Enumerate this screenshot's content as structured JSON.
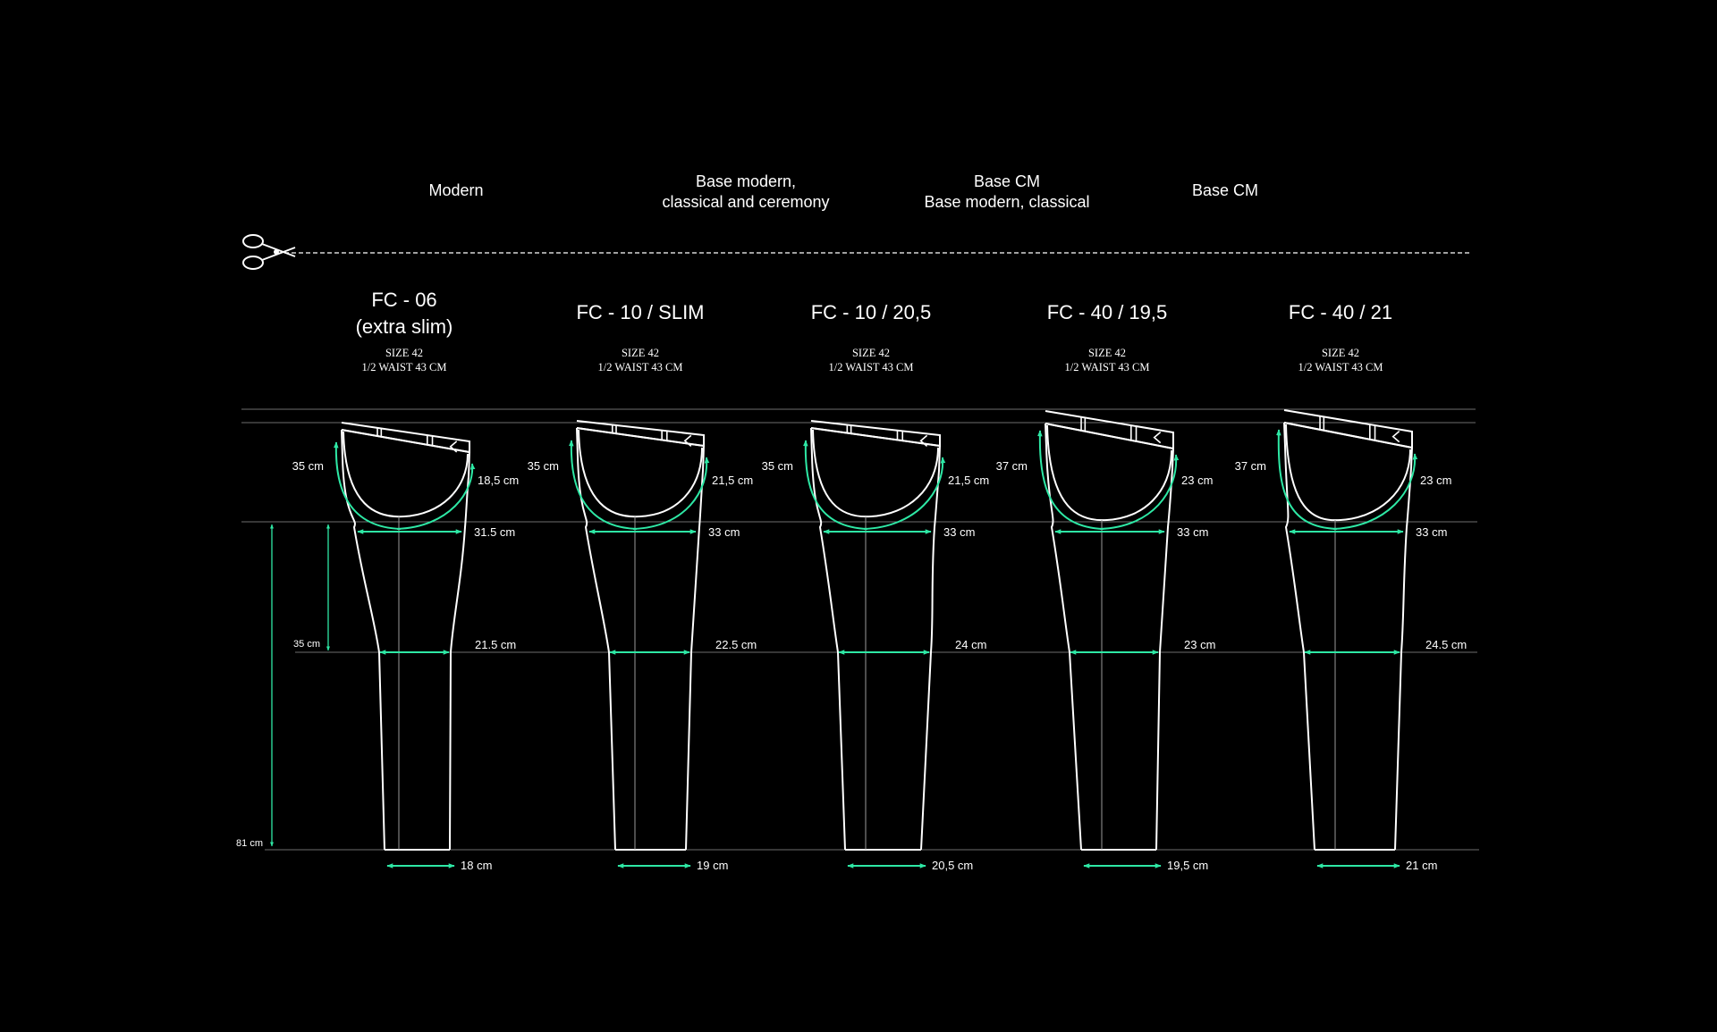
{
  "category_labels": [
    {
      "lines": [
        "Modern"
      ]
    },
    {
      "lines": [
        "Base modern,",
        "classical and ceremony"
      ]
    },
    {
      "lines": [
        "Base CM",
        "Base modern, classical"
      ]
    },
    {
      "lines": [
        "Base CM"
      ]
    }
  ],
  "colors": {
    "background": "#000000",
    "outline": "#ffffff",
    "accent": "#2ee8a5",
    "guide": "#6e6e6e"
  },
  "icons": {
    "cut_line": "scissors-icon"
  },
  "height_guides": {
    "inseam_to_knee": "35 cm",
    "inseam_total": "81 cm"
  },
  "models": [
    {
      "name_lines": [
        "FC - 06",
        "(extra slim)"
      ],
      "size": "SIZE 42",
      "waist": "1/2 WAIST 43 CM",
      "rise_front": "35 cm",
      "rise_back": "18,5 cm",
      "thigh": "31.5 cm",
      "knee": "21.5 cm",
      "hem": "18 cm"
    },
    {
      "name_lines": [
        "FC - 10 / SLIM"
      ],
      "size": "SIZE 42",
      "waist": "1/2 WAIST 43 CM",
      "rise_front": "35 cm",
      "rise_back": "21,5 cm",
      "thigh": "33 cm",
      "knee": "22.5 cm",
      "hem": "19 cm"
    },
    {
      "name_lines": [
        "FC - 10 / 20,5"
      ],
      "size": "SIZE 42",
      "waist": "1/2 WAIST 43 CM",
      "rise_front": "35 cm",
      "rise_back": "21,5 cm",
      "thigh": "33 cm",
      "knee": "24 cm",
      "hem": "20,5 cm"
    },
    {
      "name_lines": [
        "FC - 40 / 19,5"
      ],
      "size": "SIZE 42",
      "waist": "1/2 WAIST 43 CM",
      "rise_front": "37 cm",
      "rise_back": "23 cm",
      "thigh": "33 cm",
      "knee": "23 cm",
      "hem": "19,5 cm"
    },
    {
      "name_lines": [
        "FC - 40 / 21"
      ],
      "size": "SIZE 42",
      "waist": "1/2 WAIST 43 CM",
      "rise_front": "37 cm",
      "rise_back": "23 cm",
      "thigh": "33 cm",
      "knee": "24.5 cm",
      "hem": "21 cm"
    }
  ]
}
